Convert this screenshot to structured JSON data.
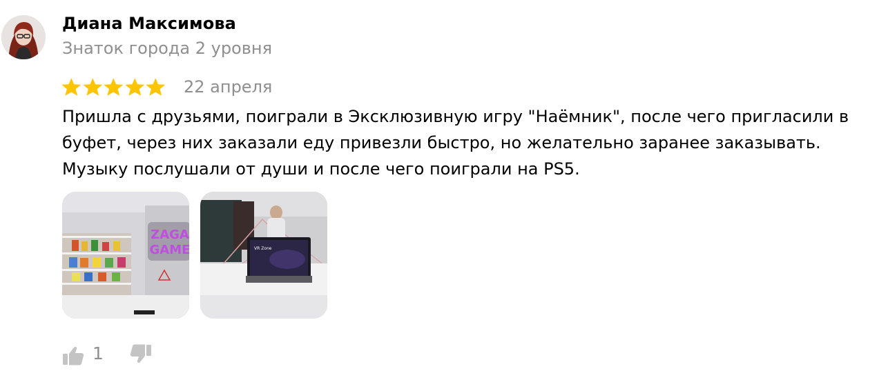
{
  "author": {
    "name": "Диана Максимова",
    "level": "Знаток города 2 уровня"
  },
  "review": {
    "rating": 5,
    "rating_max": 5,
    "date": "22 апреля",
    "text": "Пришла с друзьями, поиграли в Эксклюзивную игру \"Наёмник\", после чего пригласили в буфет, через них заказали еду привезли быстро, но желательно заранее заказывать. Музыку послушали от души и после чего поиграли на PS5.",
    "photos": [
      {
        "logo_text": [
          "ZAGA",
          "GAME"
        ]
      },
      {
        "screen_text": "VR Zone"
      }
    ]
  },
  "reactions": {
    "likes": "1",
    "like_icon": "thumbs-up-icon",
    "dislike_icon": "thumbs-down-icon"
  },
  "colors": {
    "star": "#fcc500",
    "secondary_text": "#8f8f8f",
    "icon": "#c4c4c4"
  }
}
